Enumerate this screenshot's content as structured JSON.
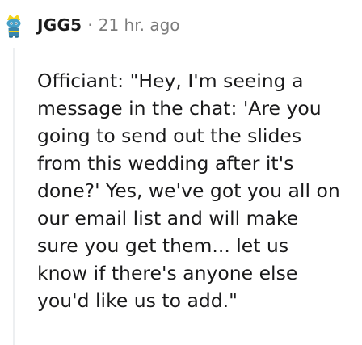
{
  "comment": {
    "username": "JGG5",
    "separator": "·",
    "timestamp": "21 hr. ago",
    "avatar_icon": "snoo-avatar-icon",
    "body_lines": [
      "Officiant: \"Hey, I'm seeing a",
      "message in the chat: 'Are you",
      "going to send out the slides",
      "from this wedding after it's",
      "done?' Yes, we've got you all on",
      "our email list and will make",
      "sure you get them... let us",
      "know if there's anyone else",
      "you'd like us to add.\""
    ]
  },
  "colors": {
    "avatar_primary": "#46a0c8",
    "avatar_hat": "#f2d21b",
    "meta_gray": "#7c7c7c",
    "thread_line": "#edeff1"
  }
}
